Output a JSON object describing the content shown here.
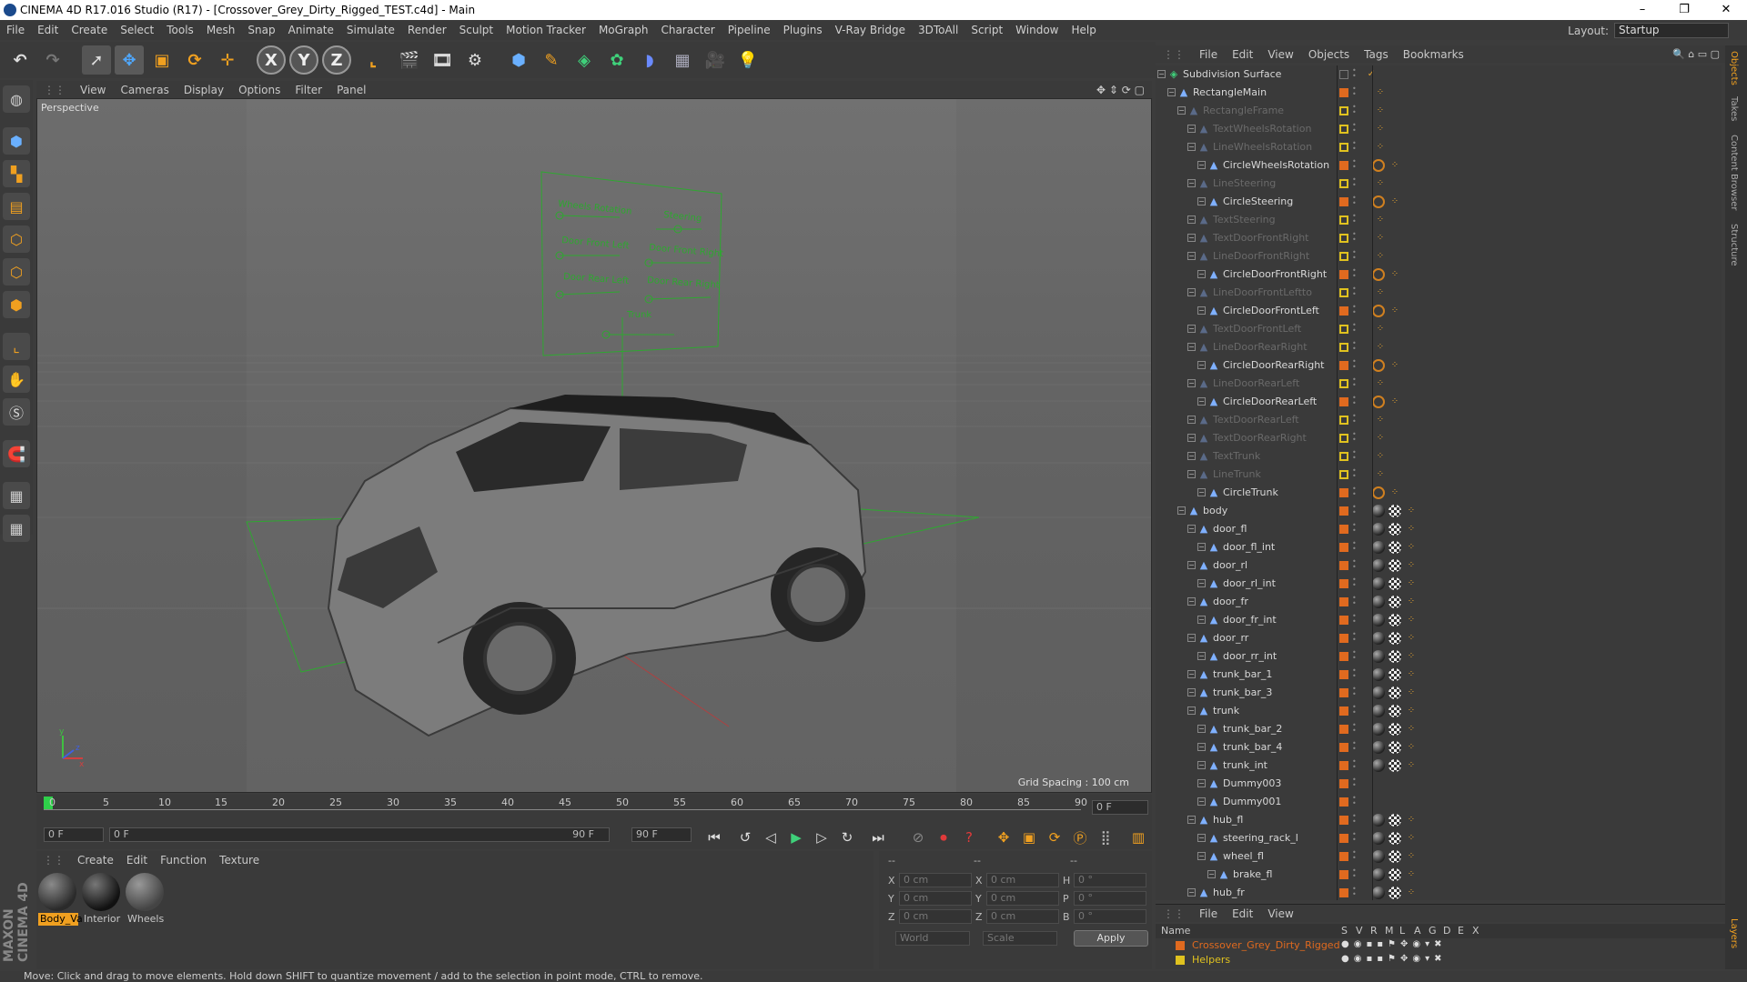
{
  "window": {
    "title": "CINEMA 4D R17.016 Studio (R17) - [Crossover_Grey_Dirty_Rigged_TEST.c4d] - Main",
    "minimize": "–",
    "maximize": "❐",
    "close": "✕"
  },
  "menu": [
    "File",
    "Edit",
    "Create",
    "Select",
    "Tools",
    "Mesh",
    "Snap",
    "Animate",
    "Simulate",
    "Render",
    "Sculpt",
    "Motion Tracker",
    "MoGraph",
    "Character",
    "Pipeline",
    "Plugins",
    "V-Ray Bridge",
    "3DToAll",
    "Script",
    "Window",
    "Help"
  ],
  "layout": {
    "label": "Layout:",
    "value": "Startup"
  },
  "toolbar": {
    "x": "X",
    "y": "Y",
    "z": "Z"
  },
  "viewport": {
    "menu": [
      "View",
      "Cameras",
      "Display",
      "Options",
      "Filter",
      "Panel"
    ],
    "label": "Perspective",
    "grid_spacing": "Grid Spacing : 100 cm",
    "hud": {
      "title_left": "Wheels Rotation",
      "title_right": "Steering",
      "door_fl": "Door Front Left",
      "door_fr": "Door Front Right",
      "door_rl": "Door Rear Left",
      "door_rr": "Door Rear Right",
      "trunk": "Trunk"
    }
  },
  "timeline": {
    "ticks": [
      "0",
      "5",
      "10",
      "15",
      "20",
      "25",
      "30",
      "35",
      "40",
      "45",
      "50",
      "55",
      "60",
      "65",
      "70",
      "75",
      "80",
      "85",
      "90"
    ],
    "current": "0 F"
  },
  "transport": {
    "start": "0 F",
    "range_start": "0 F",
    "range_end": "90 F",
    "end": "90 F"
  },
  "materials": {
    "menu": [
      "Create",
      "Edit",
      "Function",
      "Texture"
    ],
    "items": [
      {
        "name": "Body_Va"
      },
      {
        "name": "Interior"
      },
      {
        "name": "Wheels"
      }
    ]
  },
  "coords": {
    "hdr": [
      "--",
      "--",
      "--"
    ],
    "pos_x": "0 cm",
    "pos_y": "0 cm",
    "pos_z": "0 cm",
    "size_x": "0 cm",
    "size_y": "0 cm",
    "size_z": "0 cm",
    "rot_h": "0 °",
    "rot_p": "0 °",
    "rot_b": "0 °",
    "mode": "World",
    "scale": "Scale",
    "apply": "Apply"
  },
  "objects": {
    "menu": [
      "File",
      "Edit",
      "View",
      "Objects",
      "Tags",
      "Bookmarks"
    ],
    "rows": [
      {
        "name": "Subdivision Surface",
        "dim": false,
        "tags": "check"
      },
      {
        "name": "RectangleMain",
        "dim": false,
        "tags": "o"
      },
      {
        "name": "RectangleFrame",
        "dim": true,
        "tags": "y"
      },
      {
        "name": "TextWheelsRotation",
        "dim": true,
        "tags": "y"
      },
      {
        "name": "LineWheelsRotation",
        "dim": true,
        "tags": "y"
      },
      {
        "name": "CircleWheelsRotation",
        "dim": false,
        "tags": "o2"
      },
      {
        "name": "LineSteering",
        "dim": true,
        "tags": "y"
      },
      {
        "name": "CircleSteering",
        "dim": false,
        "tags": "o2"
      },
      {
        "name": "TextSteering",
        "dim": true,
        "tags": "y"
      },
      {
        "name": "TextDoorFrontRight",
        "dim": true,
        "tags": "y"
      },
      {
        "name": "LineDoorFrontRight",
        "dim": true,
        "tags": "y"
      },
      {
        "name": "CircleDoorFrontRight",
        "dim": false,
        "tags": "o2"
      },
      {
        "name": "LineDoorFrontLeftto",
        "dim": true,
        "tags": "y"
      },
      {
        "name": "CircleDoorFrontLeft",
        "dim": false,
        "tags": "o2"
      },
      {
        "name": "TextDoorFrontLeft",
        "dim": true,
        "tags": "y"
      },
      {
        "name": "LineDoorRearRight",
        "dim": true,
        "tags": "y"
      },
      {
        "name": "CircleDoorRearRight",
        "dim": false,
        "tags": "o2"
      },
      {
        "name": "LineDoorRearLeft",
        "dim": true,
        "tags": "y"
      },
      {
        "name": "CircleDoorRearLeft",
        "dim": false,
        "tags": "o2"
      },
      {
        "name": "TextDoorRearLeft",
        "dim": true,
        "tags": "y"
      },
      {
        "name": "TextDoorRearRight",
        "dim": true,
        "tags": "y"
      },
      {
        "name": "TextTrunk",
        "dim": true,
        "tags": "y"
      },
      {
        "name": "LineTrunk",
        "dim": true,
        "tags": "y"
      },
      {
        "name": "CircleTrunk",
        "dim": false,
        "tags": "o2"
      },
      {
        "name": "body",
        "dim": false,
        "tags": "m"
      },
      {
        "name": "door_fl",
        "dim": false,
        "tags": "m"
      },
      {
        "name": "door_fl_int",
        "dim": false,
        "tags": "m"
      },
      {
        "name": "door_rl",
        "dim": false,
        "tags": "m"
      },
      {
        "name": "door_rl_int",
        "dim": false,
        "tags": "m"
      },
      {
        "name": "door_fr",
        "dim": false,
        "tags": "m"
      },
      {
        "name": "door_fr_int",
        "dim": false,
        "tags": "m"
      },
      {
        "name": "door_rr",
        "dim": false,
        "tags": "m"
      },
      {
        "name": "door_rr_int",
        "dim": false,
        "tags": "m"
      },
      {
        "name": "trunk_bar_1",
        "dim": false,
        "tags": "m"
      },
      {
        "name": "trunk_bar_3",
        "dim": false,
        "tags": "m"
      },
      {
        "name": "trunk",
        "dim": false,
        "tags": "m"
      },
      {
        "name": "trunk_bar_2",
        "dim": false,
        "tags": "m"
      },
      {
        "name": "trunk_bar_4",
        "dim": false,
        "tags": "m"
      },
      {
        "name": "trunk_int",
        "dim": false,
        "tags": "m"
      },
      {
        "name": "Dummy003",
        "dim": false,
        "tags": ""
      },
      {
        "name": "Dummy001",
        "dim": false,
        "tags": ""
      },
      {
        "name": "hub_fl",
        "dim": false,
        "tags": "m"
      },
      {
        "name": "steering_rack_l",
        "dim": false,
        "tags": "m"
      },
      {
        "name": "wheel_fl",
        "dim": false,
        "tags": "m"
      },
      {
        "name": "brake_fl",
        "dim": false,
        "tags": "m"
      },
      {
        "name": "hub_fr",
        "dim": false,
        "tags": "m"
      }
    ]
  },
  "layers": {
    "menu": [
      "File",
      "Edit",
      "View"
    ],
    "header": {
      "name": "Name",
      "cols": [
        "S",
        "V",
        "R",
        "M",
        "L",
        "A",
        "G",
        "D",
        "E",
        "X"
      ]
    },
    "rows": [
      {
        "name": "Crossover_Grey_Dirty_Rigged",
        "color": "#e06a1f"
      },
      {
        "name": "Helpers",
        "color": "#e0c21f"
      }
    ]
  },
  "right_tabs": [
    "Objects",
    "Takes",
    "Content Browser",
    "Structure",
    "Layers"
  ],
  "brand": "MAXON CINEMA 4D",
  "status": "Move: Click and drag to move elements. Hold down SHIFT to quantize movement / add to the selection in point mode, CTRL to remove.",
  "colors": {
    "orange": "#e06a1f",
    "yellow": "#e0c21f",
    "accent_blue": "#2d6fd6"
  }
}
